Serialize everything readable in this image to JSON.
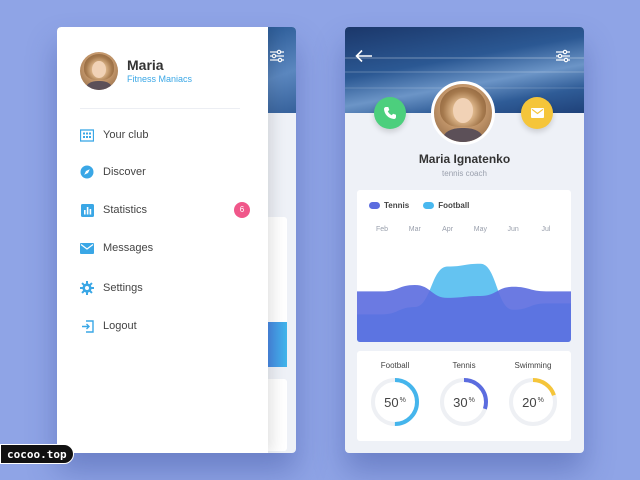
{
  "drawer": {
    "user_name": "Maria",
    "user_group": "Fitness Maniacs",
    "menu": [
      {
        "label": "Your club",
        "icon": "building-icon"
      },
      {
        "label": "Discover",
        "icon": "compass-icon"
      },
      {
        "label": "Statistics",
        "icon": "bar-chart-icon",
        "badge": "6"
      },
      {
        "label": "Messages",
        "icon": "mail-icon"
      },
      {
        "label": "Settings",
        "icon": "gear-icon"
      },
      {
        "label": "Logout",
        "icon": "logout-icon"
      }
    ]
  },
  "profile": {
    "name": "Maria Ignatenko",
    "role": "tennis coach"
  },
  "chart_data": {
    "type": "area",
    "x": [
      "Feb",
      "Mar",
      "Apr",
      "May",
      "Jun",
      "Jul"
    ],
    "series": [
      {
        "name": "Tennis",
        "color": "#5b6cdf",
        "values": [
          0.55,
          0.62,
          0.48,
          0.5,
          0.6,
          0.55
        ]
      },
      {
        "name": "Football",
        "color": "#49b8ef",
        "values": [
          0.3,
          0.38,
          0.82,
          0.85,
          0.35,
          0.42
        ]
      }
    ],
    "legend": "top-left"
  },
  "stats": [
    {
      "label": "Football",
      "value": "50",
      "unit": "%",
      "fraction": 0.5,
      "color": "#45b5ec"
    },
    {
      "label": "Tennis",
      "value": "30",
      "unit": "%",
      "fraction": 0.3,
      "color": "#5b6cdf"
    },
    {
      "label": "Swimming",
      "value": "20",
      "unit": "%",
      "fraction": 0.2,
      "color": "#f5c53a"
    }
  ],
  "colors": {
    "background": "#8fa4e6",
    "accent_blue": "#3aa7e6",
    "badge": "#f0578a",
    "call": "#4ccf7d",
    "mail": "#f5c53a"
  },
  "watermark": "cocoo.top"
}
